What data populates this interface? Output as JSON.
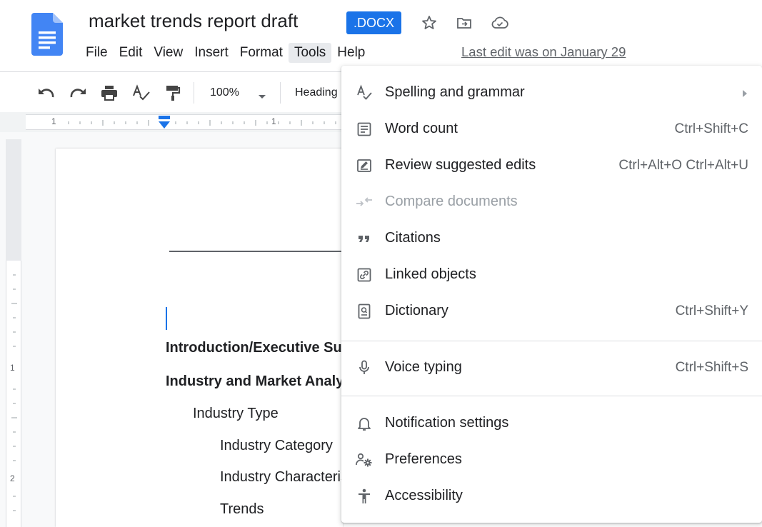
{
  "document": {
    "title": "market trends report draft",
    "format_badge": ".DOCX",
    "last_edit": "Last edit was on January 29"
  },
  "menubar": {
    "items": [
      "File",
      "Edit",
      "View",
      "Insert",
      "Format",
      "Tools",
      "Help"
    ],
    "active": "Tools"
  },
  "toolbar": {
    "zoom": "100%",
    "style": "Heading"
  },
  "rulers": {
    "h_labels": [
      "1",
      "1"
    ],
    "v_labels": [
      "1",
      "2"
    ]
  },
  "doc_outline": [
    {
      "text": "Introduction/Executive Summary",
      "bold": true,
      "level": 0
    },
    {
      "text": "Industry and Market Analysis",
      "bold": true,
      "level": 0
    },
    {
      "text": "Industry Type",
      "bold": false,
      "level": 1
    },
    {
      "text": "Industry Category",
      "bold": false,
      "level": 2
    },
    {
      "text": "Industry Characteristics",
      "bold": false,
      "level": 2
    },
    {
      "text": "Trends",
      "bold": false,
      "level": 2
    }
  ],
  "tools_menu": {
    "items": [
      {
        "label": "Spelling and grammar",
        "shortcut": "",
        "icon": "spellcheck-icon",
        "submenu": true,
        "disabled": false
      },
      {
        "label": "Word count",
        "shortcut": "Ctrl+Shift+C",
        "icon": "word-count-icon",
        "submenu": false,
        "disabled": false
      },
      {
        "label": "Review suggested edits",
        "shortcut": "Ctrl+Alt+O Ctrl+Alt+U",
        "icon": "review-edits-icon",
        "submenu": false,
        "disabled": false
      },
      {
        "label": "Compare documents",
        "shortcut": "",
        "icon": "compare-icon",
        "submenu": false,
        "disabled": true
      },
      {
        "label": "Citations",
        "shortcut": "",
        "icon": "quote-icon",
        "submenu": false,
        "disabled": false
      },
      {
        "label": "Linked objects",
        "shortcut": "",
        "icon": "link-icon",
        "submenu": false,
        "disabled": false
      },
      {
        "label": "Dictionary",
        "shortcut": "Ctrl+Shift+Y",
        "icon": "dictionary-icon",
        "submenu": false,
        "disabled": false
      },
      {
        "label": "Voice typing",
        "shortcut": "Ctrl+Shift+S",
        "icon": "microphone-icon",
        "submenu": false,
        "disabled": false
      },
      {
        "label": "Notification settings",
        "shortcut": "",
        "icon": "bell-icon",
        "submenu": false,
        "disabled": false
      },
      {
        "label": "Preferences",
        "shortcut": "",
        "icon": "preferences-icon",
        "submenu": false,
        "disabled": false
      },
      {
        "label": "Accessibility",
        "shortcut": "",
        "icon": "accessibility-icon",
        "submenu": false,
        "disabled": false
      }
    ]
  },
  "colors": {
    "accent": "#1a73e8",
    "docs_blue": "#4285f4",
    "text": "#202124",
    "muted": "#5f6368",
    "disabled": "#9aa0a6"
  }
}
